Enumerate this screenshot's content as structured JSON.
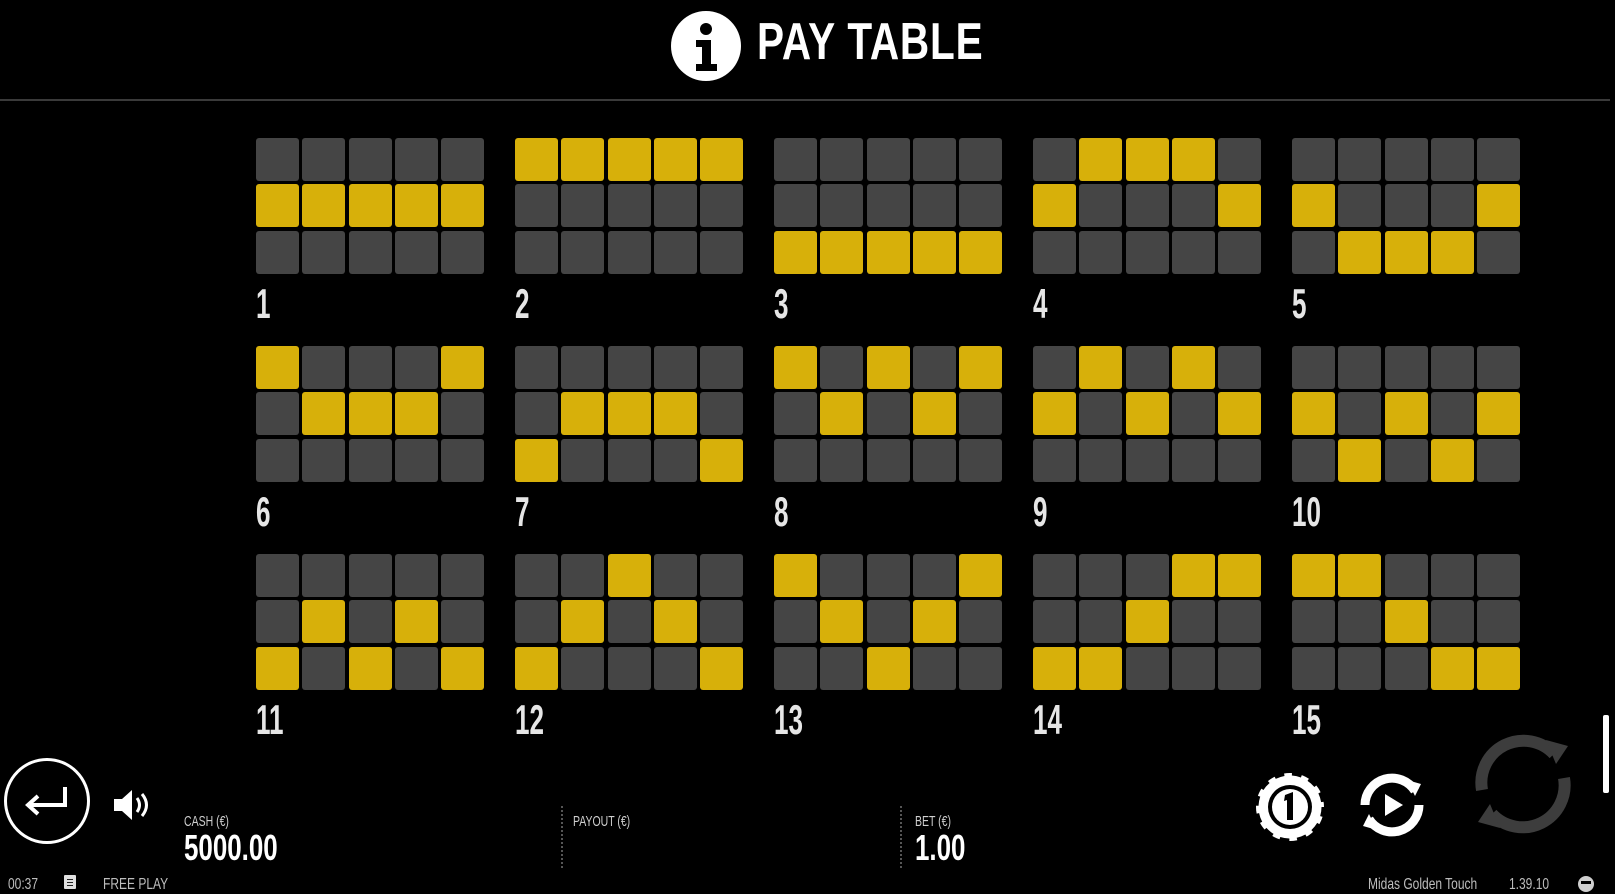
{
  "header": {
    "title": "PAY TABLE",
    "icon": "info-icon"
  },
  "paylines": [
    {
      "number": "1",
      "rows": [
        [
          0,
          0,
          0,
          0,
          0
        ],
        [
          1,
          1,
          1,
          1,
          1
        ],
        [
          0,
          0,
          0,
          0,
          0
        ]
      ]
    },
    {
      "number": "2",
      "rows": [
        [
          1,
          1,
          1,
          1,
          1
        ],
        [
          0,
          0,
          0,
          0,
          0
        ],
        [
          0,
          0,
          0,
          0,
          0
        ]
      ]
    },
    {
      "number": "3",
      "rows": [
        [
          0,
          0,
          0,
          0,
          0
        ],
        [
          0,
          0,
          0,
          0,
          0
        ],
        [
          1,
          1,
          1,
          1,
          1
        ]
      ]
    },
    {
      "number": "4",
      "rows": [
        [
          0,
          1,
          1,
          1,
          0
        ],
        [
          1,
          0,
          0,
          0,
          1
        ],
        [
          0,
          0,
          0,
          0,
          0
        ]
      ]
    },
    {
      "number": "5",
      "rows": [
        [
          0,
          0,
          0,
          0,
          0
        ],
        [
          1,
          0,
          0,
          0,
          1
        ],
        [
          0,
          1,
          1,
          1,
          0
        ]
      ]
    },
    {
      "number": "6",
      "rows": [
        [
          1,
          0,
          0,
          0,
          1
        ],
        [
          0,
          1,
          1,
          1,
          0
        ],
        [
          0,
          0,
          0,
          0,
          0
        ]
      ]
    },
    {
      "number": "7",
      "rows": [
        [
          0,
          0,
          0,
          0,
          0
        ],
        [
          0,
          1,
          1,
          1,
          0
        ],
        [
          1,
          0,
          0,
          0,
          1
        ]
      ]
    },
    {
      "number": "8",
      "rows": [
        [
          1,
          0,
          1,
          0,
          1
        ],
        [
          0,
          1,
          0,
          1,
          0
        ],
        [
          0,
          0,
          0,
          0,
          0
        ]
      ]
    },
    {
      "number": "9",
      "rows": [
        [
          0,
          1,
          0,
          1,
          0
        ],
        [
          1,
          0,
          1,
          0,
          1
        ],
        [
          0,
          0,
          0,
          0,
          0
        ]
      ]
    },
    {
      "number": "10",
      "rows": [
        [
          0,
          0,
          0,
          0,
          0
        ],
        [
          1,
          0,
          1,
          0,
          1
        ],
        [
          0,
          1,
          0,
          1,
          0
        ]
      ]
    },
    {
      "number": "11",
      "rows": [
        [
          0,
          0,
          0,
          0,
          0
        ],
        [
          0,
          1,
          0,
          1,
          0
        ],
        [
          1,
          0,
          1,
          0,
          1
        ]
      ]
    },
    {
      "number": "12",
      "rows": [
        [
          0,
          0,
          1,
          0,
          0
        ],
        [
          0,
          1,
          0,
          1,
          0
        ],
        [
          1,
          0,
          0,
          0,
          1
        ]
      ]
    },
    {
      "number": "13",
      "rows": [
        [
          1,
          0,
          0,
          0,
          1
        ],
        [
          0,
          1,
          0,
          1,
          0
        ],
        [
          0,
          0,
          1,
          0,
          0
        ]
      ]
    },
    {
      "number": "14",
      "rows": [
        [
          0,
          0,
          0,
          1,
          1
        ],
        [
          0,
          0,
          1,
          0,
          0
        ],
        [
          1,
          1,
          0,
          0,
          0
        ]
      ]
    },
    {
      "number": "15",
      "rows": [
        [
          1,
          1,
          0,
          0,
          0
        ],
        [
          0,
          0,
          1,
          0,
          0
        ],
        [
          0,
          0,
          0,
          1,
          1
        ]
      ]
    }
  ],
  "colors": {
    "active_cell": "#d7b00a",
    "inactive_cell": "#454545",
    "background": "#000000"
  },
  "bottom_bar": {
    "cash_label": "CASH (€)",
    "cash_value": "5000.00",
    "payout_label": "PAYOUT (€)",
    "payout_value": "",
    "bet_label": "BET (€)",
    "bet_value": "1.00"
  },
  "footer": {
    "time": "00:37",
    "mode": "FREE PLAY",
    "game_name": "Midas Golden Touch",
    "version": "1.39.10"
  }
}
